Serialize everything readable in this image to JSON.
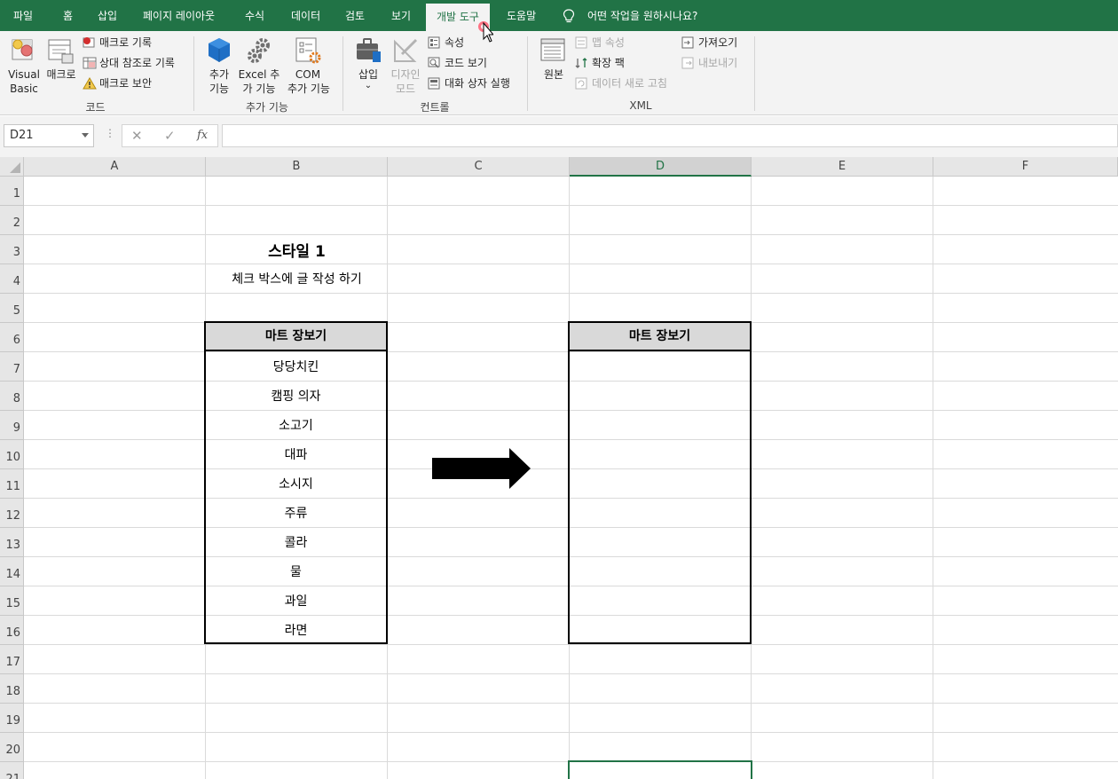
{
  "menu": {
    "tabs": [
      "파일",
      "홈",
      "삽입",
      "페이지 레이아웃",
      "수식",
      "데이터",
      "검토",
      "보기",
      "개발 도구",
      "도움말"
    ],
    "active_tab": "개발 도구",
    "tell_me": "어떤 작업을 원하시나요?"
  },
  "ribbon": {
    "code": {
      "visual_basic_1": "Visual",
      "visual_basic_2": "Basic",
      "macro": "매크로",
      "record_macro": "매크로 기록",
      "relative_ref": "상대 참조로 기록",
      "macro_security": "매크로 보안",
      "label": "코드"
    },
    "addins": {
      "addins_1": "추가",
      "addins_2": "기능",
      "excel_addins_1": "Excel 추",
      "excel_addins_2": "가 기능",
      "com_addins_1": "COM",
      "com_addins_2": "추가 기능",
      "label": "추가 기능"
    },
    "controls": {
      "insert": "삽입",
      "insert_arrow": "⌄",
      "design_mode_1": "디자인",
      "design_mode_2": "모드",
      "properties": "속성",
      "view_code": "코드 보기",
      "run_dialog": "대화 상자 실행",
      "label": "컨트롤"
    },
    "xml": {
      "source": "원본",
      "map_properties": "맵 속성",
      "expansion_packs": "확장 팩",
      "refresh_data": "데이터 새로 고침",
      "import": "가져오기",
      "export": "내보내기",
      "label": "XML"
    }
  },
  "formula_bar": {
    "name_box": "D21",
    "dots": "⋮",
    "cancel": "✕",
    "enter": "✓",
    "fx": "fx",
    "formula": ""
  },
  "grid": {
    "columns": [
      "A",
      "B",
      "C",
      "D",
      "E",
      "F"
    ],
    "selected_column": "D",
    "rows": [
      "1",
      "2",
      "3",
      "4",
      "5",
      "6",
      "7",
      "8",
      "9",
      "10",
      "11",
      "12",
      "13",
      "14",
      "15",
      "16",
      "17",
      "18",
      "19",
      "20",
      "21"
    ]
  },
  "sheet": {
    "title": "스타일 1",
    "subtitle": "체크 박스에 글 작성 하기",
    "left_table": {
      "header": "마트 장보기",
      "items": [
        "당당치킨",
        "캠핑 의자",
        "소고기",
        "대파",
        "소시지",
        "주류",
        "콜라",
        "물",
        "과일",
        "라면"
      ]
    },
    "right_table": {
      "header": "마트 장보기"
    }
  },
  "colors": {
    "excel_green": "#217346",
    "header_fill": "#d9d9d9"
  }
}
